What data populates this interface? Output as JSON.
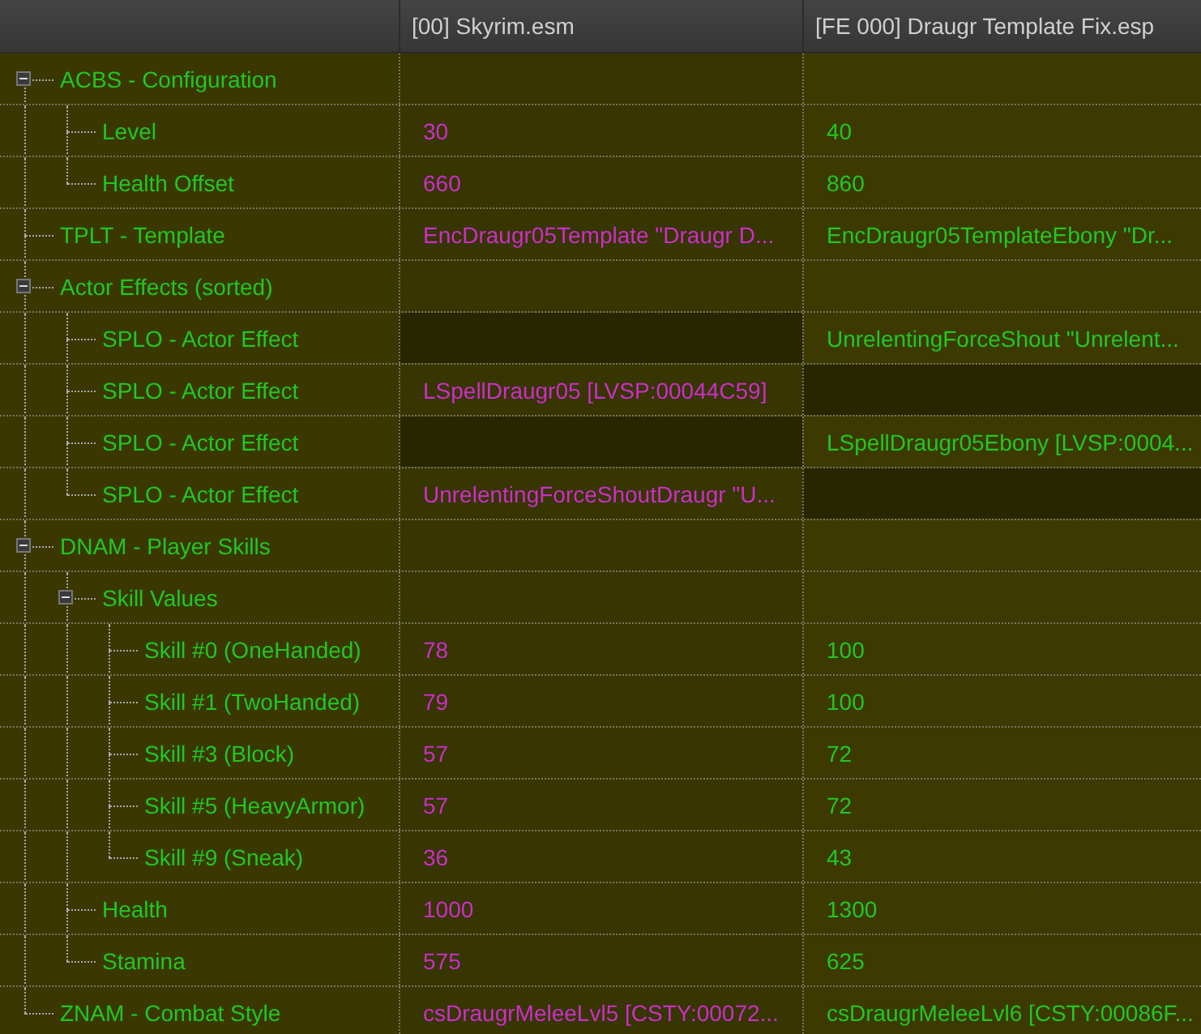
{
  "header": {
    "columns": [
      "[00] Skyrim.esm",
      "[FE 000] Draugr Template Fix.esp"
    ]
  },
  "tree": [
    {
      "label": "ACBS - Configuration",
      "expanded": true,
      "children": [
        {
          "label": "Level",
          "values": [
            {
              "text": "30",
              "kind": "overridden"
            },
            {
              "text": "40",
              "kind": "winner"
            }
          ]
        },
        {
          "label": "Health Offset",
          "values": [
            {
              "text": "660",
              "kind": "overridden"
            },
            {
              "text": "860",
              "kind": "winner"
            }
          ]
        }
      ]
    },
    {
      "label": "TPLT - Template",
      "values": [
        {
          "text": "EncDraugr05Template \"Draugr D...",
          "kind": "overridden"
        },
        {
          "text": "EncDraugr05TemplateEbony \"Dr...",
          "kind": "winner"
        }
      ]
    },
    {
      "label": "Actor Effects (sorted)",
      "expanded": true,
      "children": [
        {
          "label": "SPLO - Actor Effect",
          "values": [
            {
              "kind": "missing"
            },
            {
              "text": "UnrelentingForceShout \"Unrelent...",
              "kind": "winner"
            }
          ]
        },
        {
          "label": "SPLO - Actor Effect",
          "values": [
            {
              "text": "LSpellDraugr05 [LVSP:00044C59]",
              "kind": "overridden"
            },
            {
              "kind": "missing"
            }
          ]
        },
        {
          "label": "SPLO - Actor Effect",
          "values": [
            {
              "kind": "missing"
            },
            {
              "text": "LSpellDraugr05Ebony [LVSP:0004...",
              "kind": "winner"
            }
          ]
        },
        {
          "label": "SPLO - Actor Effect",
          "values": [
            {
              "text": "UnrelentingForceShoutDraugr \"U...",
              "kind": "overridden"
            },
            {
              "kind": "missing"
            }
          ]
        }
      ]
    },
    {
      "label": "DNAM - Player Skills",
      "expanded": true,
      "children": [
        {
          "label": "Skill Values",
          "expanded": true,
          "children": [
            {
              "label": "Skill #0 (OneHanded)",
              "values": [
                {
                  "text": "78",
                  "kind": "overridden"
                },
                {
                  "text": "100",
                  "kind": "winner"
                }
              ]
            },
            {
              "label": "Skill #1 (TwoHanded)",
              "values": [
                {
                  "text": "79",
                  "kind": "overridden"
                },
                {
                  "text": "100",
                  "kind": "winner"
                }
              ]
            },
            {
              "label": "Skill #3 (Block)",
              "values": [
                {
                  "text": "57",
                  "kind": "overridden"
                },
                {
                  "text": "72",
                  "kind": "winner"
                }
              ]
            },
            {
              "label": "Skill #5 (HeavyArmor)",
              "values": [
                {
                  "text": "57",
                  "kind": "overridden"
                },
                {
                  "text": "72",
                  "kind": "winner"
                }
              ]
            },
            {
              "label": "Skill #9 (Sneak)",
              "values": [
                {
                  "text": "36",
                  "kind": "overridden"
                },
                {
                  "text": "43",
                  "kind": "winner"
                }
              ]
            }
          ]
        },
        {
          "label": "Health",
          "values": [
            {
              "text": "1000",
              "kind": "overridden"
            },
            {
              "text": "1300",
              "kind": "winner"
            }
          ]
        },
        {
          "label": "Stamina",
          "values": [
            {
              "text": "575",
              "kind": "overridden"
            },
            {
              "text": "625",
              "kind": "winner"
            }
          ]
        }
      ]
    },
    {
      "label": "ZNAM - Combat Style",
      "values": [
        {
          "text": "csDraugrMeleeLvl5 [CSTY:00072...",
          "kind": "overridden"
        },
        {
          "text": "csDraugrMeleeLvl6 [CSTY:00086F...",
          "kind": "winner"
        }
      ]
    }
  ]
}
